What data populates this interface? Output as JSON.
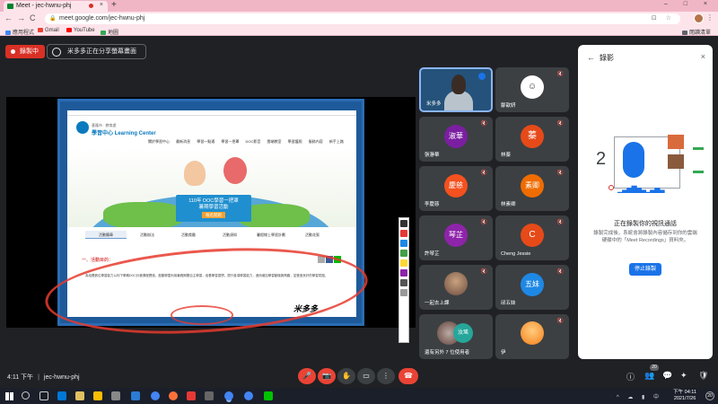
{
  "browser": {
    "tab_title": "Meet - jec-hwnu-phj",
    "tab_close": "×",
    "new_tab": "+",
    "window_controls": "–  □  ×",
    "url": "meet.google.com/jec-hwnu-phj",
    "nav_back": "←",
    "nav_forward": "→",
    "nav_reload": "C",
    "omni_icons": "⊡ ☆",
    "menu": "⋮",
    "bookmarks": [
      "應用程式",
      "Gmail",
      "YouTube",
      "地圖"
    ],
    "reading_list": "閱讀清單"
  },
  "meet": {
    "recording_label": "錄製中",
    "presenting_label": "米多多正在分享螢幕畫面",
    "meeting_code": "jec-hwnu-phj",
    "time": "4:11 下午",
    "separator": "|"
  },
  "shared_site": {
    "org_line": "基隆市 · 教育處",
    "logo_text": "學習中心 Learning Center",
    "nav": [
      "關於學習中心",
      "最新消息",
      "學習一點通",
      "學習一把罩",
      "DOC影音",
      "雲端教室",
      "學習護照",
      "服務內容",
      "新手上路"
    ],
    "hero_title": "110年 DOC學習一把罩",
    "hero_sub1": "暑期學習活動",
    "hero_sub2": "報名開跑",
    "tabs": [
      "活動簡章",
      "活動辦法",
      "活動獎勵",
      "活動須知",
      "暑假線上學習計劃",
      "活動花絮"
    ],
    "section": "一、活動目的：",
    "body": "為培養數位學習能力以利下學期DOC計畫課程實施，鼓勵學童利用暑假期間自主學習，培養學習習慣，提升各項學習能力，進而增加學習動機與興趣，並營造良好的學習氛圍。",
    "signature": "米多多"
  },
  "participants": [
    {
      "name": "米多多",
      "self": true
    },
    {
      "name": "鄒歆妍",
      "avatar": "☺",
      "color": "#ffffff"
    },
    {
      "name": "張瀞華",
      "avatar": "淑華",
      "color": "#7b1fa2"
    },
    {
      "name": "林蓁",
      "avatar": "蓁",
      "color": "#e64a19"
    },
    {
      "name": "李慶慈",
      "avatar": "慶慈",
      "color": "#f4511e"
    },
    {
      "name": "林素卿",
      "avatar": "素卿",
      "color": "#ef6c00"
    },
    {
      "name": "許琴芷",
      "avatar": "琴芷",
      "color": "#8e24aa"
    },
    {
      "name": "Cheng Jessie",
      "avatar": "C",
      "color": "#e64a19"
    },
    {
      "name": "一起去上課",
      "avatar": "",
      "color": "#6d4c41"
    },
    {
      "name": "邱五妹",
      "avatar": "五妹",
      "color": "#1e88e5"
    },
    {
      "name": "還有另外 7 位使用者",
      "avatar": "汝瑤",
      "color": "#26a69a"
    },
    {
      "name": "伊",
      "avatar": "",
      "color": "#f57f17"
    }
  ],
  "panel": {
    "title": "錄影",
    "back": "←",
    "close": "×",
    "message": "正在錄製你的視訊通話",
    "detail": "錄製完成後，系統會將錄製內容儲存到你的雲端硬碟中的「Meet Recordings」資料夾。",
    "stop_button": "停止錄製"
  },
  "controls": {
    "mic": "🎤",
    "cam": "📷",
    "hand": "✋",
    "present": "▭",
    "more": "⋮",
    "end": "☎",
    "info": "ⓘ",
    "people": "👥",
    "chat": "💬",
    "activities": "✦",
    "host": "🛡",
    "people_count": "20"
  },
  "taskbar": {
    "time": "下午 04:11",
    "date": "2021/7/26",
    "tray_icons": "^ ☁ ▮ 中",
    "notif_count": "20"
  }
}
